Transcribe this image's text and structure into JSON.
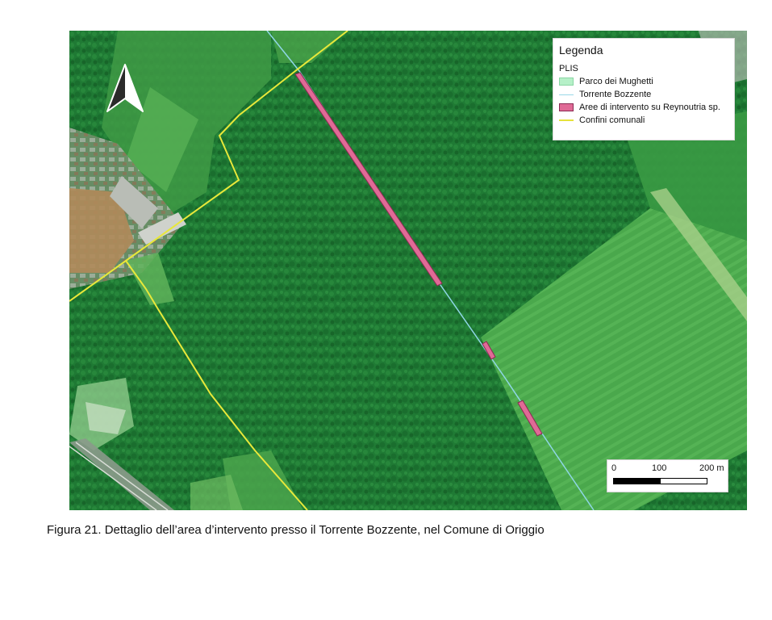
{
  "map": {
    "type": "satellite map excerpt",
    "north_arrow_icon": "north-arrow-icon",
    "colors": {
      "forest": "#1f7a34",
      "field_light": "#5fb35a",
      "field_dark": "#2e8f3d",
      "boundary_line": "#e8e83a",
      "stream_line": "#8fd6e6",
      "intervention_fill": "#e06a96"
    }
  },
  "legend": {
    "title": "Legenda",
    "group_label": "PLIS",
    "items": [
      {
        "label": "Parco dei Mughetti",
        "symbol": "fill",
        "color": "#b6f0c8",
        "stroke": "#8ad6a4"
      },
      {
        "label": "Torrente Bozzente",
        "symbol": "line",
        "color": "#9ad8e8"
      },
      {
        "label": "Aree di intervento su Reynoutria sp.",
        "symbol": "fill",
        "color": "#e06a96",
        "stroke": "#8a2a52"
      },
      {
        "label": "Confini comunali",
        "symbol": "line",
        "color": "#e6e23a"
      }
    ]
  },
  "scalebar": {
    "labels": [
      "0",
      "100",
      "200 m"
    ],
    "unit": "m"
  },
  "caption": "Figura 21. Dettaglio dell’area d’intervento presso il Torrente Bozzente, nel Comune di Origgio"
}
